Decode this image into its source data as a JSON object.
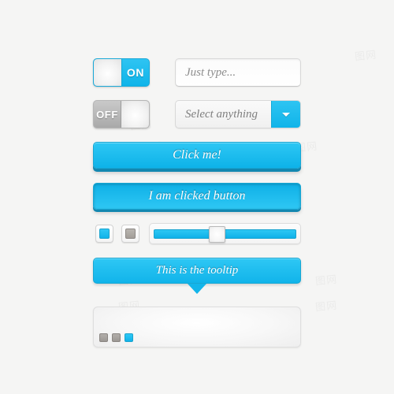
{
  "page": {
    "background_color": "#f5f5f4",
    "accent_color": "#17b5ea",
    "accent_dark_color": "#1287b0",
    "gray_color": "#a9a9a9"
  },
  "toggle_on": {
    "label": "ON",
    "state": "on",
    "knob_position": "left"
  },
  "toggle_off": {
    "label": "OFF",
    "state": "off",
    "knob_position": "right"
  },
  "text_input": {
    "value": "",
    "placeholder": "Just type..."
  },
  "select": {
    "value": "Select anything",
    "caret_icon": "chevron-down-icon"
  },
  "buttons": {
    "primary": {
      "label": "Click me!",
      "state": "default"
    },
    "clicked": {
      "label": "I am clicked button",
      "state": "pressed"
    }
  },
  "checkboxes": [
    {
      "name": "checkbox-blue",
      "checked": true,
      "color": "#17b5ea"
    },
    {
      "name": "checkbox-gray",
      "checked": true,
      "color": "#a39e99"
    }
  ],
  "slider": {
    "value": 43,
    "min": 0,
    "max": 100,
    "fill_color": "#17b5ea"
  },
  "tooltip": {
    "label": "This is the tooltip",
    "arrow_direction": "down"
  },
  "panel": {
    "content": "",
    "pager": [
      {
        "name": "pager-dot-1",
        "active": false
      },
      {
        "name": "pager-dot-2",
        "active": false
      },
      {
        "name": "pager-dot-3",
        "active": true
      }
    ]
  },
  "watermarks": {
    "text": "图网"
  }
}
